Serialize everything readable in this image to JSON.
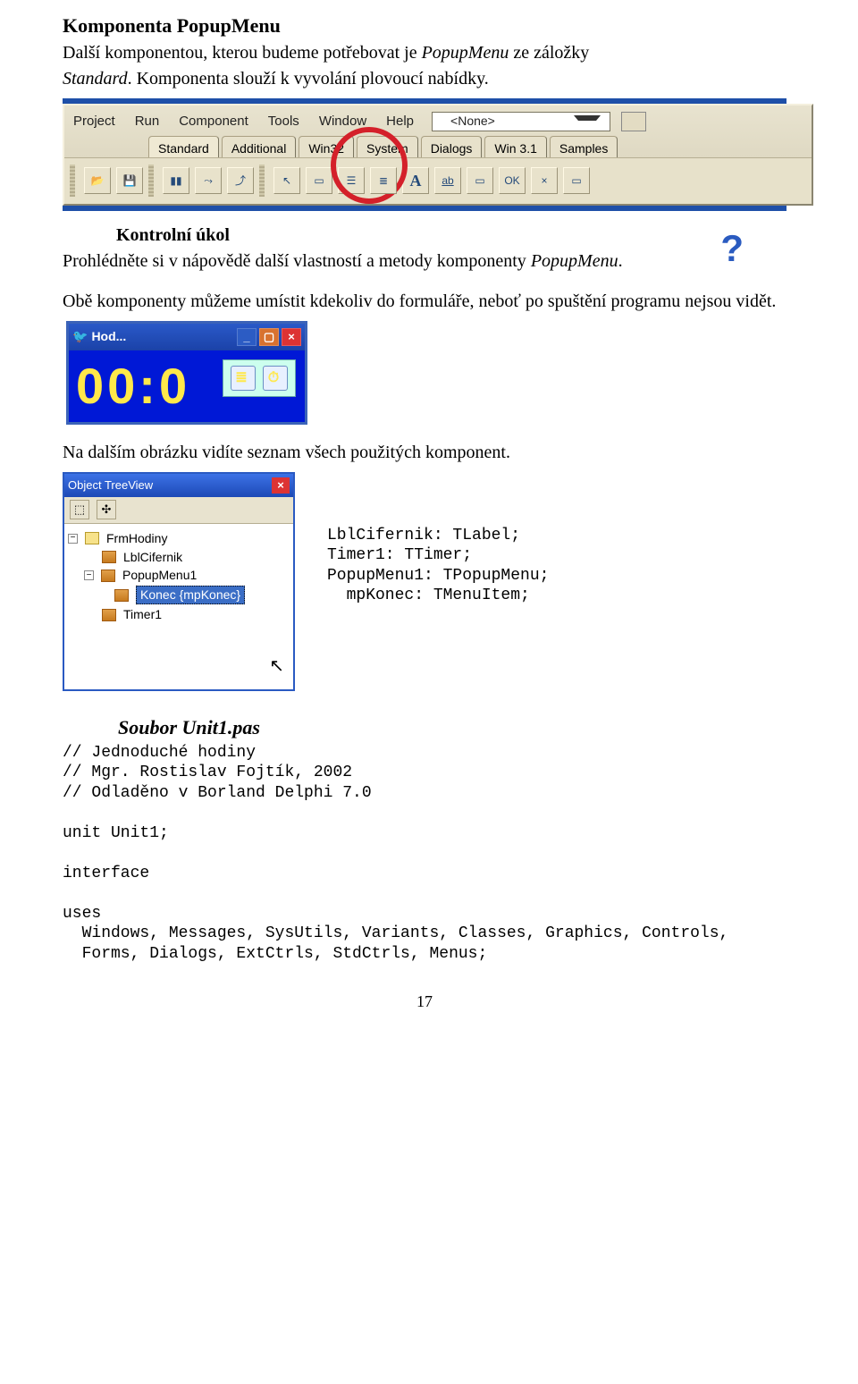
{
  "title": "Komponenta PopupMenu",
  "intro_1": "Další komponentou, kterou budeme potřebovat je ",
  "intro_em": "PopupMenu",
  "intro_2": " ze záložky ",
  "intro_em2": "Standard",
  "intro_3": ". Komponenta slouží k vyvolání plovoucí nabídky.",
  "toolbar": {
    "menus": [
      "Project",
      "Run",
      "Component",
      "Tools",
      "Window",
      "Help"
    ],
    "combo_value": "<None>",
    "tabs": [
      "Standard",
      "Additional",
      "Win32",
      "System",
      "Dialogs",
      "Win 3.1",
      "Samples"
    ],
    "buttons": [
      "A",
      "ab",
      "▭",
      "OK",
      "×",
      "▭"
    ]
  },
  "kontrol_label": "Kontrolní úkol",
  "kontrol_text_1": "Prohlédněte si v nápovědě další vlastností a metody komponenty ",
  "kontrol_em": "PopupMenu",
  "kontrol_text_2": ".",
  "both_text": "Obě komponenty můžeme umístit kdekoliv do formuláře, neboť po spuštění programu nejsou vidět.",
  "hod": {
    "title_prefix": "Hod...",
    "display": "00:0"
  },
  "after_hod": "Na dalším obrázku vidíte seznam všech použitých komponent.",
  "treeview": {
    "title": "Object TreeView",
    "items": {
      "root": "FrmHodiny",
      "lbl": "LblCifernik",
      "popup": "PopupMenu1",
      "konec": "Konec {mpKonec}",
      "timer": "Timer1"
    }
  },
  "decl_code": "LblCifernik: TLabel;\nTimer1: TTimer;\nPopupMenu1: TPopupMenu;\n  mpKonec: TMenuItem;",
  "soubor_title": "Soubor Unit1.pas",
  "code_block": "// Jednoduché hodiny\n// Mgr. Rostislav Fojtík, 2002\n// Odladěno v Borland Delphi 7.0\n\nunit Unit1;\n\ninterface\n\nuses\n  Windows, Messages, SysUtils, Variants, Classes, Graphics, Controls,\n  Forms, Dialogs, ExtCtrls, StdCtrls, Menus;",
  "page_number": "17"
}
